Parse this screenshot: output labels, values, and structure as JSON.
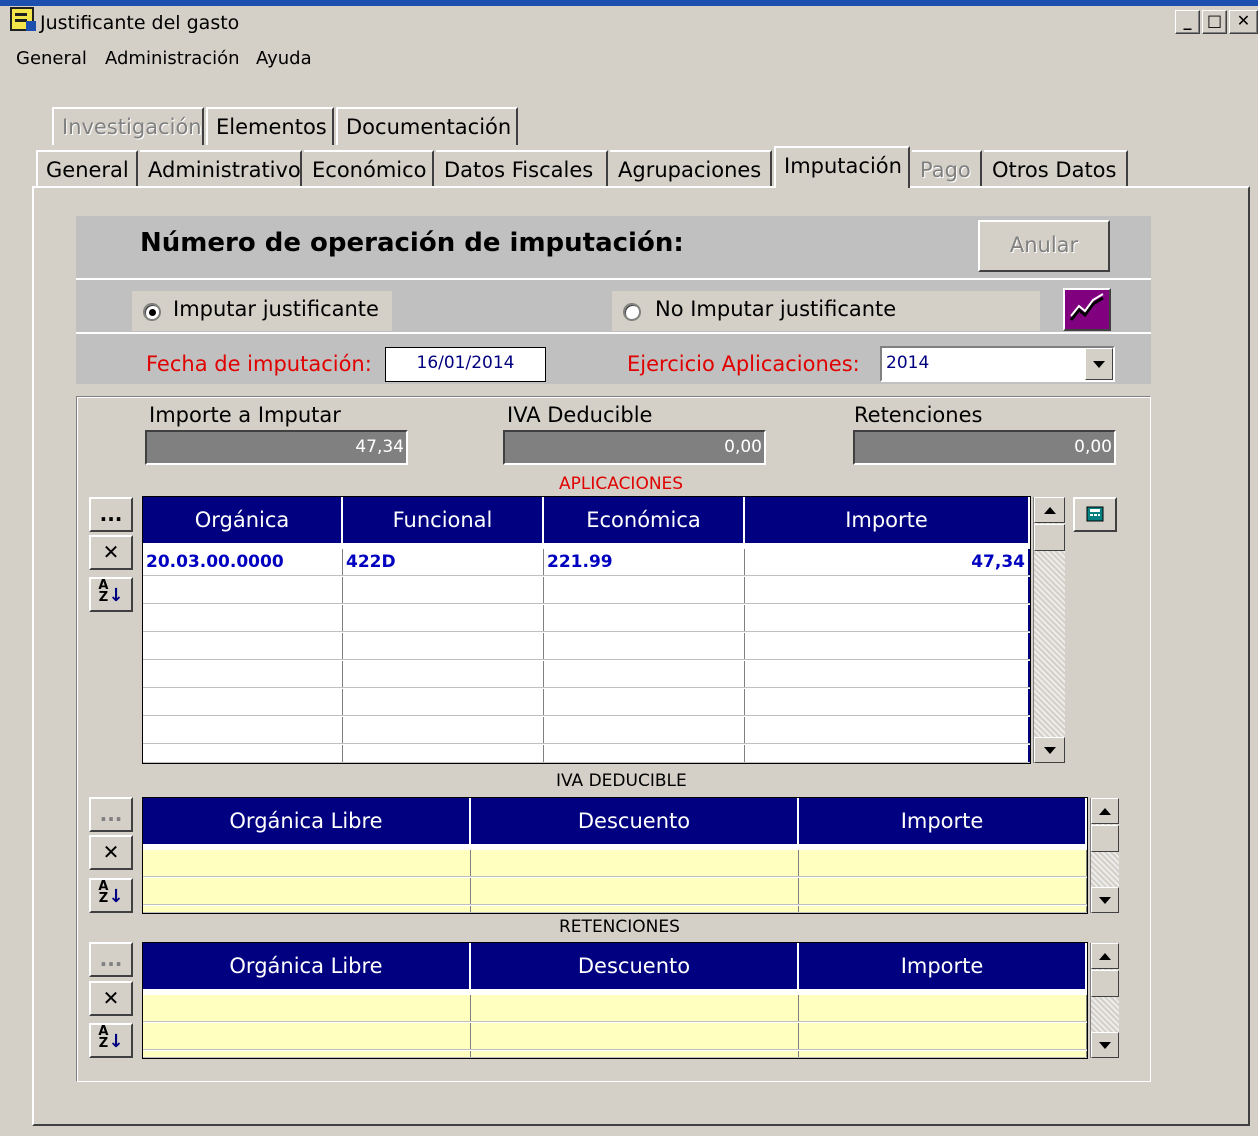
{
  "window": {
    "title": "Justificante del gasto"
  },
  "menu": {
    "items": [
      "General",
      "Administración",
      "Ayuda"
    ]
  },
  "tabs_row1": [
    "Investigación",
    "Elementos",
    "Documentación"
  ],
  "tabs_row2": [
    "General",
    "Administrativo",
    "Económico",
    "Datos Fiscales",
    "Agrupaciones",
    "Imputación",
    "Pago",
    "Otros Datos"
  ],
  "header": {
    "op_title": "Número de operación de imputación:",
    "anular_label": "Anular",
    "radio_imputar": "Imputar justificante",
    "radio_no_imputar": "No Imputar justificante",
    "fecha_label": "Fecha de imputación:",
    "fecha_value": "16/01/2014",
    "ejercicio_label": "Ejercicio Aplicaciones:",
    "ejercicio_value": "2014"
  },
  "amounts": {
    "importe_label": "Importe a Imputar",
    "importe_value": "47,34",
    "iva_label": "IVA Deducible",
    "iva_value": "0,00",
    "ret_label": "Retenciones",
    "ret_value": "0,00"
  },
  "aplicaciones": {
    "title": "APLICACIONES",
    "columns": [
      "Orgánica",
      "Funcional",
      "Económica",
      "Importe"
    ],
    "rows": [
      {
        "organica": "20.03.00.0000",
        "funcional": "422D",
        "economica": "221.99",
        "importe": "47,34"
      }
    ]
  },
  "iva_deducible": {
    "title": "IVA DEDUCIBLE",
    "columns": [
      "Orgánica Libre",
      "Descuento",
      "Importe"
    ]
  },
  "retenciones": {
    "title": "RETENCIONES",
    "columns": [
      "Orgánica Libre",
      "Descuento",
      "Importe"
    ]
  },
  "side_buttons": {
    "more": "...",
    "delete": "✕"
  },
  "colors": {
    "grid_header": "#000080",
    "label_red": "#e00000",
    "yellow_row": "#ffffc0",
    "chart_button": "#800080"
  }
}
